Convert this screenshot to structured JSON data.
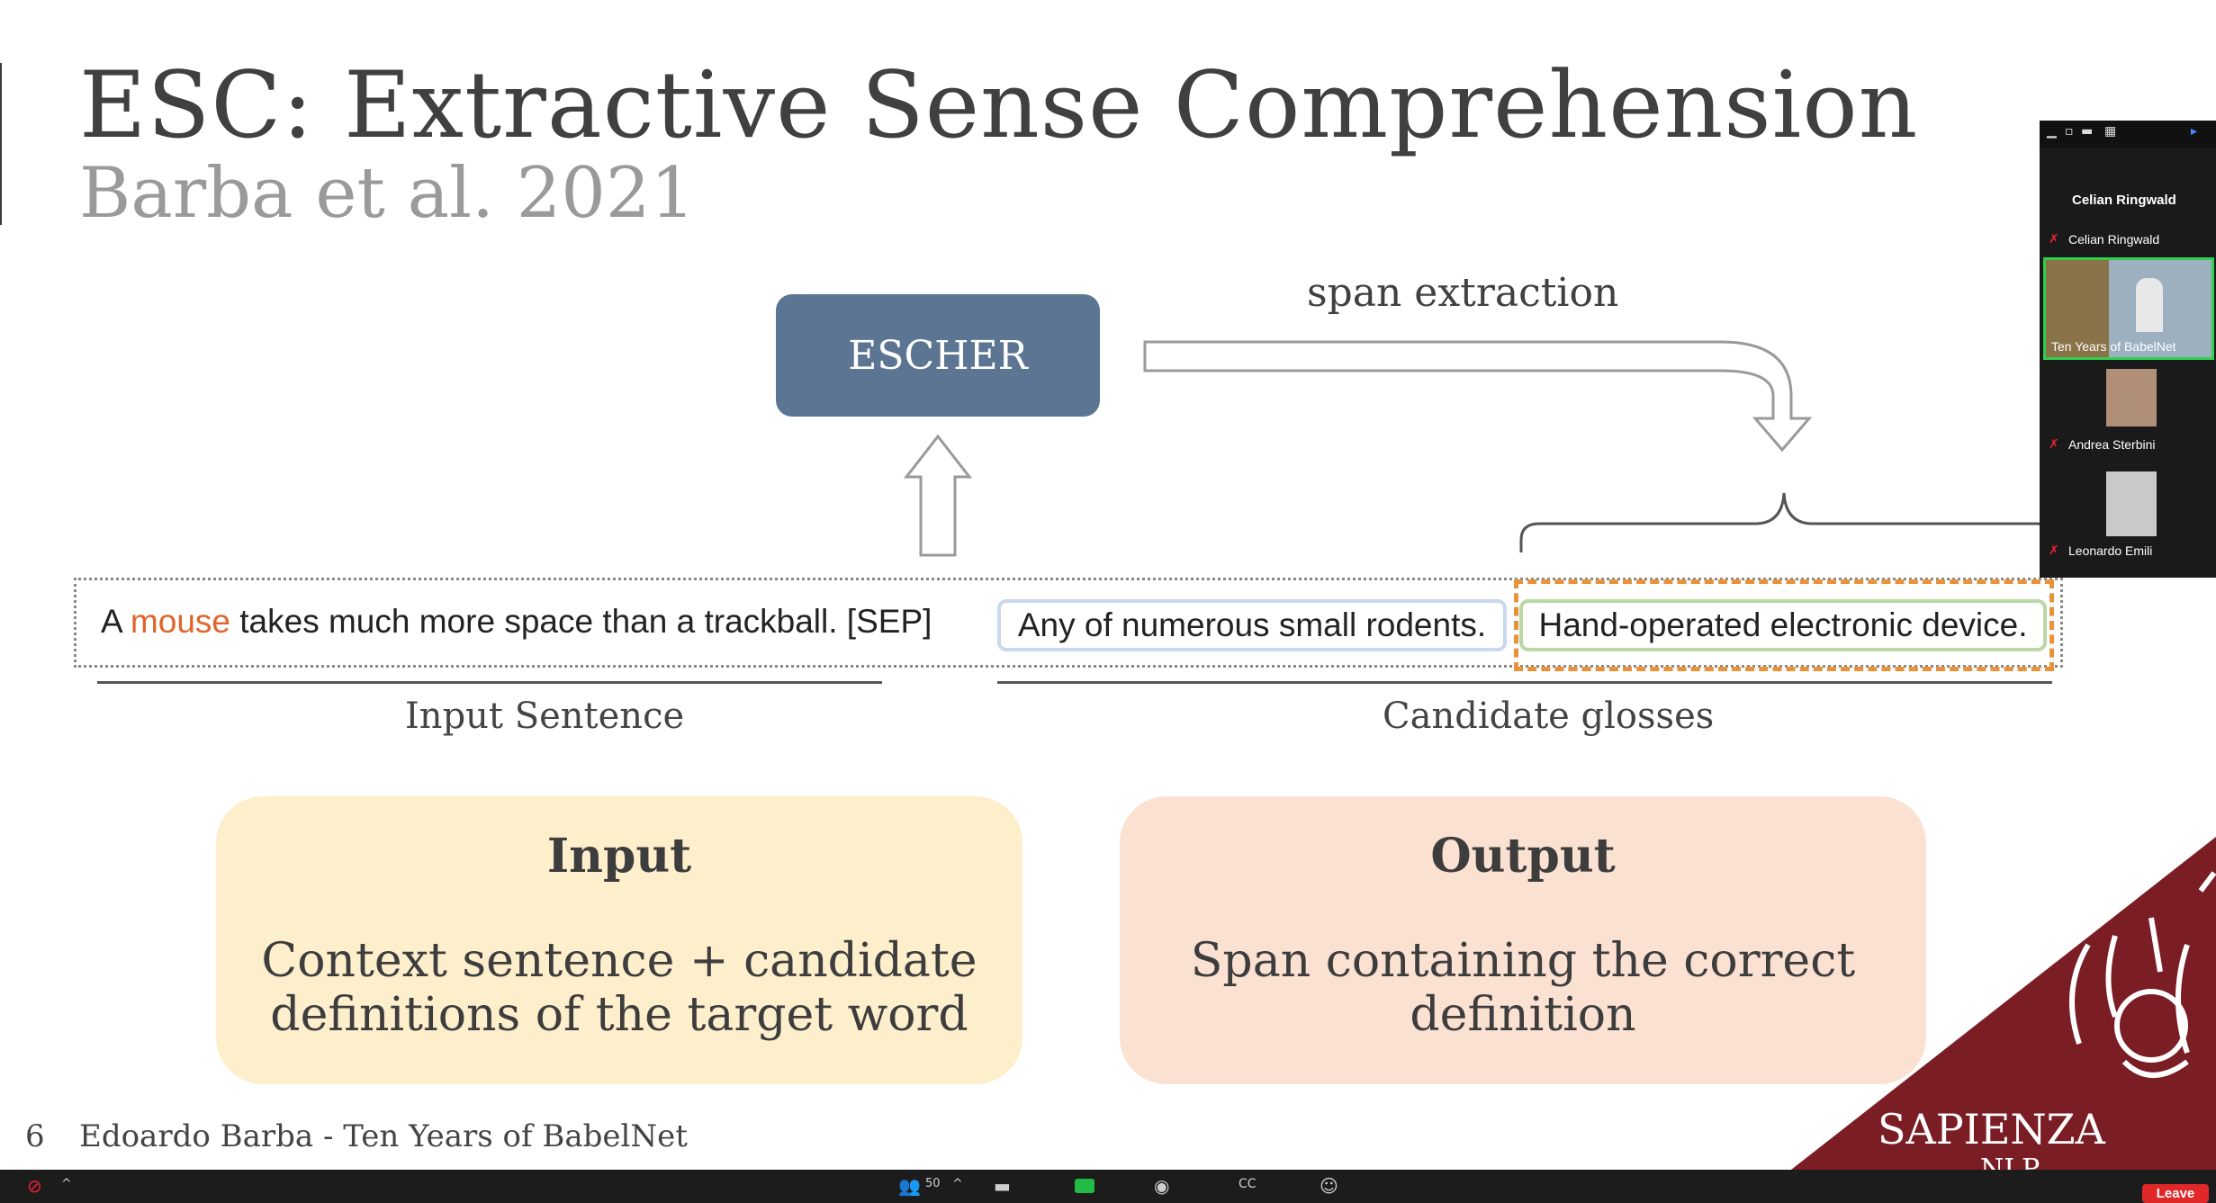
{
  "slide": {
    "title": "ESC: Extractive Sense Comprehension",
    "subtitle": "Barba et al. 2021",
    "escher_label": "ESCHER",
    "span_label": "span extraction",
    "sentence": {
      "prefix": "A ",
      "target_word": "mouse",
      "rest": " takes much more space than a trackball. [SEP]"
    },
    "gloss_1": "Any of numerous small rodents.",
    "gloss_2": "Hand-operated electronic device.",
    "label_input_sentence": "Input Sentence",
    "label_candidate_glosses": "Candidate glosses",
    "input_card": {
      "heading": "Input",
      "body": "Context sentence + candidate definitions of the target word"
    },
    "output_card": {
      "heading": "Output",
      "body": "Span containing the correct definition"
    },
    "footer_page": "6",
    "footer_text": "Edoardo Barba - Ten Years of BabelNet",
    "logo_text": "SAPIENZA",
    "logo_subtext": "NLP"
  },
  "colors": {
    "escher_box": "#5c7592",
    "target_word": "#e0652a",
    "input_card": "#fdeecc",
    "output_card": "#fbe1d1",
    "logo_triangle": "#7a1d24",
    "selected_span": "#e8923a"
  },
  "participants": {
    "speaker_header": "Celian Ringwald",
    "items": [
      {
        "name": "Celian Ringwald",
        "muted": true
      },
      {
        "name": "Ten Years of BabelNet",
        "muted": false,
        "active": true
      },
      {
        "name": "Andrea Sterbini",
        "muted": true
      },
      {
        "name": "Leonardo Emili",
        "muted": true
      }
    ]
  },
  "toolbar": {
    "participants_count": "50",
    "leave_label": "Leave",
    "icons": [
      "video-off-icon",
      "participants-icon",
      "chat-icon",
      "share-screen-icon",
      "record-icon",
      "captions-icon",
      "reactions-icon"
    ]
  }
}
